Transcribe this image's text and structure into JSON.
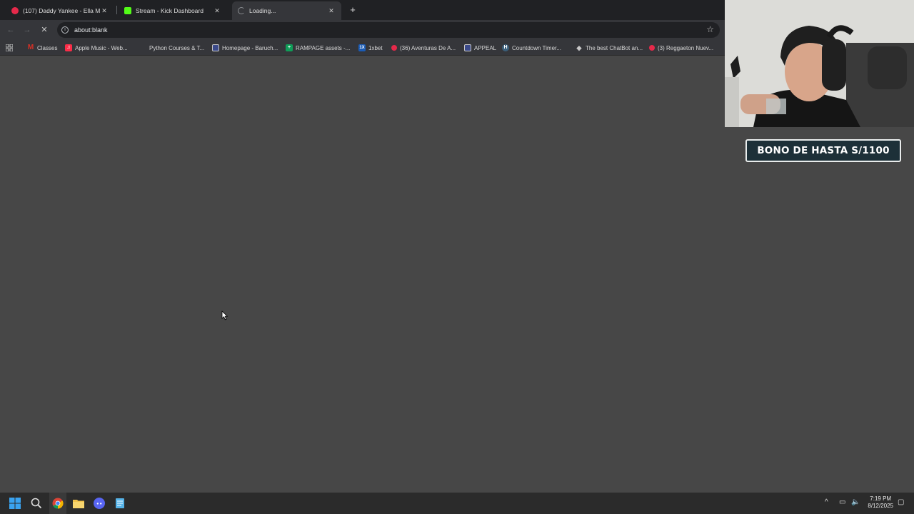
{
  "tabs": [
    {
      "title": "(107) Daddy Yankee - Ella Me L",
      "favicon_color": "#e5294a"
    },
    {
      "title": "Stream - Kick Dashboard",
      "favicon_color": "#53fc18"
    },
    {
      "title": "Loading...",
      "favicon_color": "#5f6368"
    }
  ],
  "address_bar": {
    "url": "about:blank"
  },
  "bookmarks": [
    {
      "label": "Classes",
      "icon": "gmail-icon",
      "color": "#d93025"
    },
    {
      "label": "Apple Music - Web...",
      "icon": "apple-music-icon",
      "color": "#fa2d48"
    },
    {
      "label": "Python Courses & T...",
      "icon": "python-icon",
      "color": "#35363a"
    },
    {
      "label": "Homepage - Baruch...",
      "icon": "baruch-icon",
      "color": "#3b4a8a"
    },
    {
      "label": "RAMPAGE assets -...",
      "icon": "sheets-icon",
      "color": "#0f9d58"
    },
    {
      "label": "1xbet",
      "icon": "1xbet-icon",
      "color": "#1a5bb5"
    },
    {
      "label": "(36) Aventuras De A...",
      "icon": "youtube-icon",
      "color": "#e5294a"
    },
    {
      "label": "APPEAL",
      "icon": "appeal-icon",
      "color": "#3b4a8a"
    },
    {
      "label": "Countdown Timer...",
      "icon": "timer-icon",
      "color": "#3b5f7a"
    },
    {
      "label": "The best ChatBot an...",
      "icon": "chatbot-icon",
      "color": "#c8c8c8"
    },
    {
      "label": "(3) Reggaeton Nuev...",
      "icon": "youtube-icon",
      "color": "#e5294a"
    }
  ],
  "overlay": {
    "promo_text": "BONO DE HASTA S/1100"
  },
  "taskbar": {
    "time": "7:19 PM",
    "date": "8/12/2025"
  }
}
